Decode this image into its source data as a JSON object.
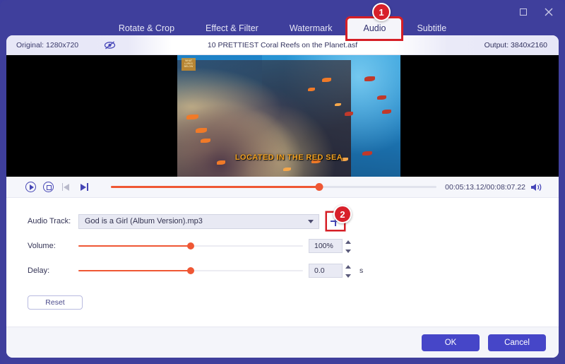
{
  "window": {
    "controls": {
      "maximize": "maximize-icon",
      "close": "close-icon"
    }
  },
  "tabs": [
    {
      "label": "Rotate & Crop",
      "active": false
    },
    {
      "label": "Effect & Filter",
      "active": false
    },
    {
      "label": "Watermark",
      "active": false
    },
    {
      "label": "Audio",
      "active": true
    },
    {
      "label": "Subtitle",
      "active": false
    }
  ],
  "badges": [
    {
      "id": "1",
      "target": "audio-tab"
    },
    {
      "id": "2",
      "target": "add-audio-track-button"
    }
  ],
  "info": {
    "original": "Original: 1280x720",
    "preview_toggle_icon": "eye-off-icon",
    "filename": "10 PRETTIEST Coral Reefs on the Planet.asf",
    "output": "Output: 3840x2160"
  },
  "video": {
    "subtitle_text": "LOCATED IN THE RED SEA",
    "watermark_text": "WHAT LURKS BELOW"
  },
  "player": {
    "play_icon": "play-icon",
    "stop_icon": "stop-icon",
    "prev_icon": "previous-frame-icon",
    "next_icon": "next-frame-icon",
    "volume_icon": "volume-icon",
    "progress_percent": 64,
    "timecode": "00:05:13.12/00:08:07.22"
  },
  "form": {
    "audio_track_label": "Audio Track:",
    "audio_track_value": "God is a Girl (Album Version).mp3",
    "add_button_icon": "plus-icon",
    "volume_label": "Volume:",
    "volume_value": "100%",
    "volume_percent": 50,
    "delay_label": "Delay:",
    "delay_value": "0.0",
    "delay_unit": "s",
    "delay_percent": 50,
    "reset_label": "Reset"
  },
  "footer": {
    "ok_label": "OK",
    "cancel_label": "Cancel"
  },
  "colors": {
    "window_chrome": "#3f3f9c",
    "accent_slider": "#ef5734",
    "badge_red": "#d8202a",
    "primary_button": "#4646c8"
  }
}
